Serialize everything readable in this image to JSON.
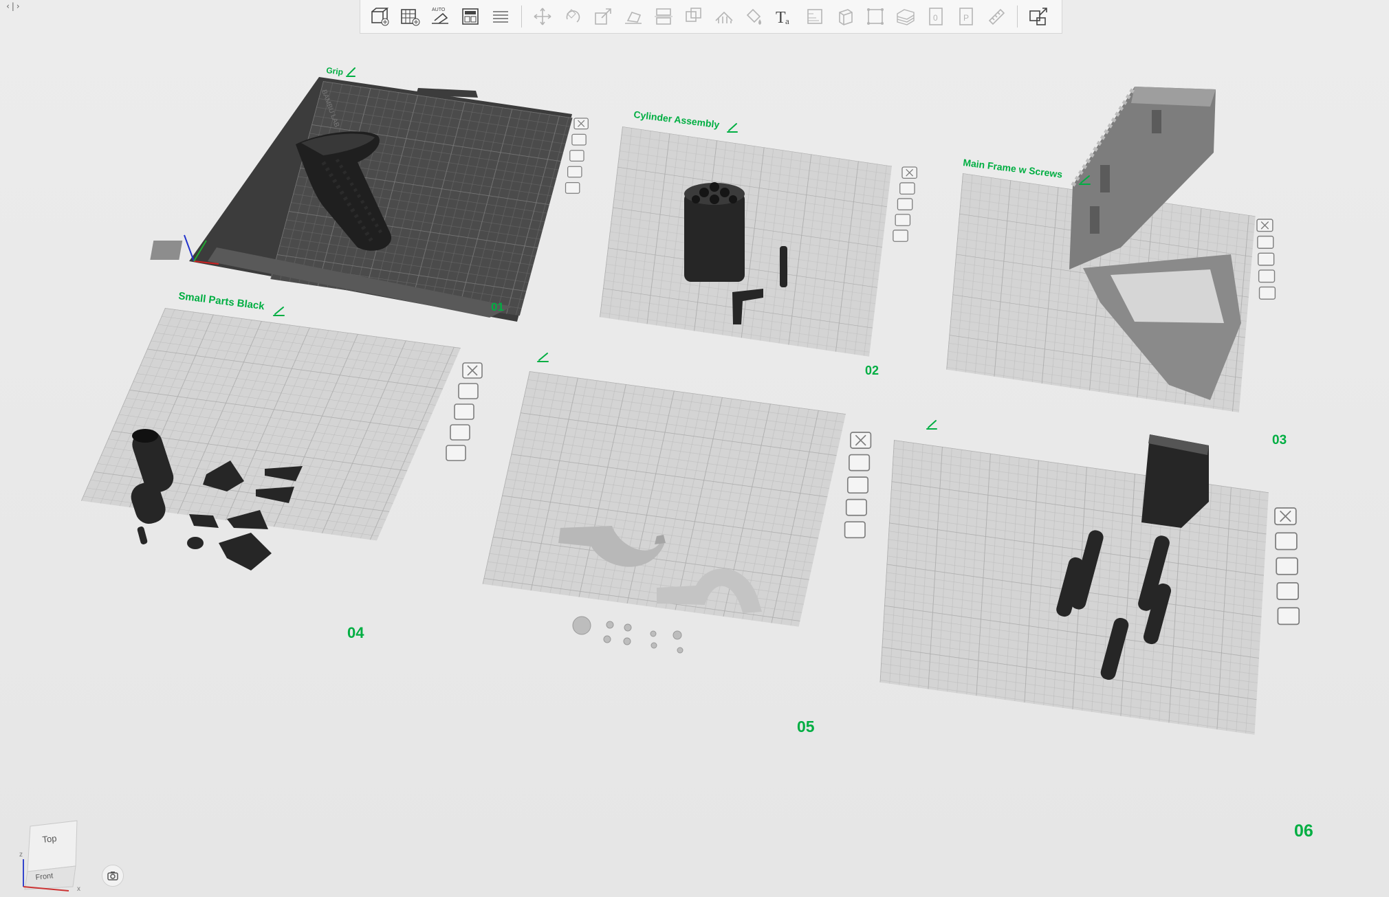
{
  "app": {
    "corner_glyph": "‹|›"
  },
  "toolbar": {
    "buttons": [
      {
        "id": "add",
        "icon": "add-object-icon",
        "enabled": true
      },
      {
        "id": "add-plate",
        "icon": "add-plate-icon",
        "enabled": true
      },
      {
        "id": "auto-orient",
        "icon": "auto-orient-icon",
        "enabled": true,
        "badge": "AUTO"
      },
      {
        "id": "arrange",
        "icon": "arrange-icon",
        "enabled": true
      },
      {
        "id": "split-layers",
        "icon": "layers-icon",
        "enabled": true
      },
      {
        "id": "move",
        "icon": "move-icon",
        "enabled": false
      },
      {
        "id": "rotate",
        "icon": "rotate-icon",
        "enabled": false
      },
      {
        "id": "scale",
        "icon": "scale-icon",
        "enabled": false
      },
      {
        "id": "lay-flat",
        "icon": "lay-on-face-icon",
        "enabled": false
      },
      {
        "id": "cut",
        "icon": "cut-icon",
        "enabled": false
      },
      {
        "id": "boolean",
        "icon": "boolean-icon",
        "enabled": false
      },
      {
        "id": "support-paint",
        "icon": "support-paint-icon",
        "enabled": false
      },
      {
        "id": "color-paint",
        "icon": "color-paint-icon",
        "enabled": false
      },
      {
        "id": "text",
        "icon": "text-icon",
        "enabled": true
      },
      {
        "id": "variable-layer",
        "icon": "variable-layer-icon",
        "enabled": false
      },
      {
        "id": "assembly",
        "icon": "assembly-icon",
        "enabled": false
      },
      {
        "id": "measure",
        "icon": "measure-icon",
        "enabled": false
      },
      {
        "id": "seam",
        "icon": "seam-icon",
        "enabled": false
      },
      {
        "id": "zero-plate",
        "icon": "plate-zero-icon",
        "enabled": false
      },
      {
        "id": "plate-p",
        "icon": "plate-p-icon",
        "enabled": false
      },
      {
        "id": "ruler",
        "icon": "ruler-icon",
        "enabled": false
      },
      {
        "id": "explode",
        "icon": "explode-icon",
        "enabled": true
      }
    ]
  },
  "plates": [
    {
      "number": "01",
      "name": "Grip",
      "selected": true,
      "object_color": "#2e2e2e"
    },
    {
      "number": "02",
      "name": "Cylinder Assembly",
      "selected": false,
      "object_color": "#2e2e2e"
    },
    {
      "number": "03",
      "name": "Main Frame w Screws",
      "selected": false,
      "object_color": "#8a8a8a"
    },
    {
      "number": "04",
      "name": "Small Parts Black",
      "selected": false,
      "object_color": "#2e2e2e"
    },
    {
      "number": "05",
      "name": "",
      "selected": false,
      "object_color": "#b9b9b9"
    },
    {
      "number": "06",
      "name": "",
      "selected": false,
      "object_color": "#2e2e2e"
    }
  ],
  "plate_tools": [
    "close-icon",
    "orient-plate-icon",
    "arrange-plate-icon",
    "lock-icon",
    "settings-icon"
  ],
  "colors": {
    "accent": "#00ae42",
    "plate_light": "#d3d3d3",
    "plate_dark": "#4d4d4d",
    "grid_light": "#bdbdbd",
    "grid_dark": "#6a6a6a"
  },
  "view_cube": {
    "top": "Top",
    "front": "Front",
    "axis_x": "x",
    "axis_z": "z"
  }
}
